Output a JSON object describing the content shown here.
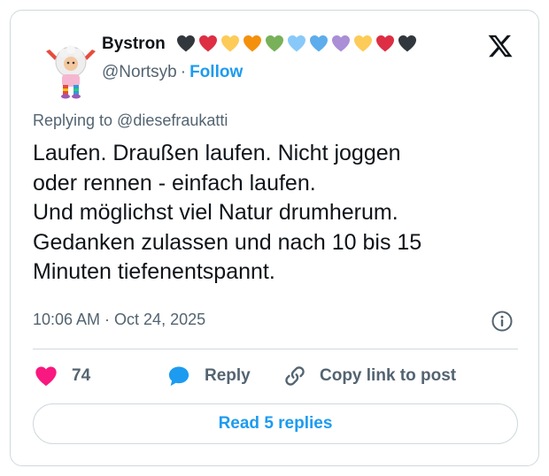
{
  "author": {
    "display_name": "Bystron",
    "handle": "@Nortsyb",
    "separator": "·",
    "follow_label": "Follow",
    "heart_colors": [
      "#31373d",
      "#dd2e44",
      "#fdcb58",
      "#f4900c",
      "#78b159",
      "#88c9f9",
      "#5dadec",
      "#aa8ed6",
      "#fdcb58",
      "#dd2e44",
      "#31373d"
    ]
  },
  "platform_icon": "x-logo-icon",
  "tweet": {
    "replying_to": "Replying to @diesefraukatti",
    "lines": [
      "Laufen. Draußen laufen. Nicht joggen",
      "oder rennen - einfach laufen.",
      "Und möglichst viel Natur drumherum.",
      "Gedanken zulassen und nach 10 bis 15",
      "Minuten tiefenentspannt."
    ],
    "timestamp": "10:06 AM · Oct 24, 2025"
  },
  "actions": {
    "like_count": "74",
    "reply_label": "Reply",
    "copy_link_label": "Copy link to post"
  },
  "footer": {
    "read_replies_label": "Read 5 replies"
  },
  "colors": {
    "accent": "#1d9bf0",
    "like": "#f91880",
    "muted": "#536471",
    "text": "#0f1419",
    "border": "#cfd9de"
  }
}
